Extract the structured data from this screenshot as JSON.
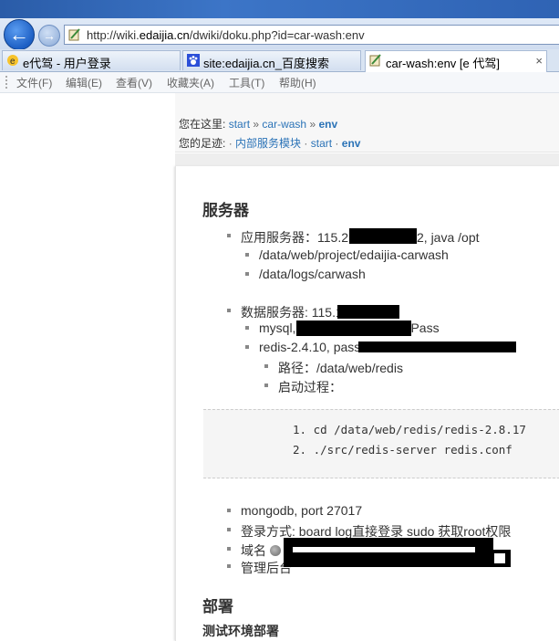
{
  "browser": {
    "url": "http://wiki.edaijia.cn/dwiki/doku.php?id=car-wash:env",
    "url_prefix": "http://wiki.",
    "url_domain": "edaijia.cn",
    "url_rest": "/dwiki/doku.php?id=car-wash:env",
    "back_glyph": "←",
    "forward_glyph": "→",
    "tabs": [
      {
        "label": "e代驾 - 用户登录",
        "icon": "edaijia-favicon"
      },
      {
        "label": "site:edaijia.cn_百度搜索",
        "icon": "baidu-paw-icon"
      },
      {
        "label": "car-wash:env [e 代驾]",
        "icon": "dokuwiki-icon",
        "active": true,
        "close": "×"
      }
    ],
    "menu": [
      "文件(F)",
      "编辑(E)",
      "查看(V)",
      "收藏夹(A)",
      "工具(T)",
      "帮助(H)"
    ]
  },
  "breadcrumbs": {
    "here_label": "您在这里:",
    "here_items": [
      "start",
      "car-wash",
      "env"
    ],
    "here_sep": "»",
    "trace_label": "您的足迹:",
    "trace_items": [
      "内部服务模块",
      "start",
      "env"
    ],
    "trace_sep": "·"
  },
  "doc": {
    "h_servers": "服务器",
    "app_server": "应用服务器：115.2",
    "app_server_tail": "2, java /opt",
    "app_paths": [
      "/data/web/project/edaijia-carwash",
      "/data/logs/carwash"
    ],
    "db_server": "数据服务器: 115.1",
    "mysql": "mysql,",
    "mysql_tail": "Pass",
    "redis": "redis-2.4.10, pass",
    "redis_path": "路径：/data/web/redis",
    "redis_start": "启动过程：",
    "code": [
      "1. cd /data/web/redis/redis-2.8.17",
      "2. ./src/redis-server redis.conf"
    ],
    "mongodb": "mongodb, port 27017",
    "login": "登录方式: board log直接登录 sudo 获取root权限",
    "domain": "域名",
    "admin": "管理后台",
    "h_deploy": "部署",
    "h_test_deploy": "测试环境部署"
  }
}
